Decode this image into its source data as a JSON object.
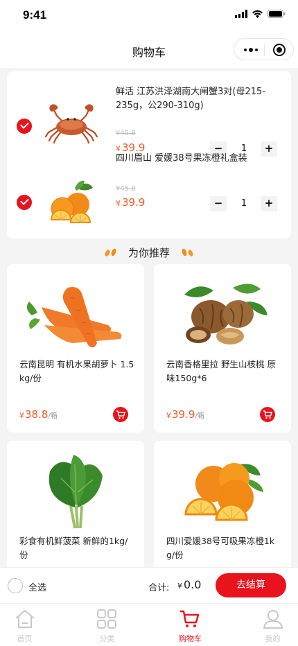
{
  "status": {
    "time": "9:41"
  },
  "nav": {
    "title": "购物车"
  },
  "cart": {
    "items": [
      {
        "name": "鲜活 江苏洪泽湖南大闸蟹3对(母215-235g，公290-310g)",
        "old_price": "¥45.8",
        "currency": "¥",
        "price": "39.9",
        "qty": "1",
        "checked": true,
        "icon": "crab"
      },
      {
        "name": "四川眉山 爱媛38号果冻橙礼盒装",
        "old_price": "¥45.8",
        "currency": "¥",
        "price": "39.9",
        "qty": "1",
        "checked": true,
        "icon": "orange"
      }
    ],
    "minus": "−",
    "plus": "+"
  },
  "recommend": {
    "title": "为你推荐",
    "products": [
      {
        "name": "云南昆明 有机水果胡萝卜 1.5kg/份",
        "currency": "¥",
        "price": "38.8",
        "unit": "/箱",
        "icon": "carrot"
      },
      {
        "name": "云南香格里拉 野生山核桃 原味150g*6",
        "currency": "¥",
        "price": "39.9",
        "unit": "/箱",
        "icon": "walnut"
      },
      {
        "name": "彩食有机鲜菠菜 新鲜的1kg/份",
        "icon": "spinach"
      },
      {
        "name": "四川爱媛38号可吸果冻橙1kg/份",
        "icon": "orange"
      }
    ]
  },
  "footer": {
    "select_all": "全选",
    "total_label": "合计:",
    "currency": "¥",
    "total": "0.0",
    "checkout": "去结算"
  },
  "tabs": [
    {
      "label": "首页",
      "icon": "home-icon",
      "active": false
    },
    {
      "label": "分类",
      "icon": "category-icon",
      "active": false
    },
    {
      "label": "购物车",
      "icon": "cart-icon",
      "active": true
    },
    {
      "label": "我的",
      "icon": "user-icon",
      "active": false
    }
  ],
  "colors": {
    "accent": "#e8131c",
    "price": "#f15a22",
    "background": "#f4f4f4"
  }
}
